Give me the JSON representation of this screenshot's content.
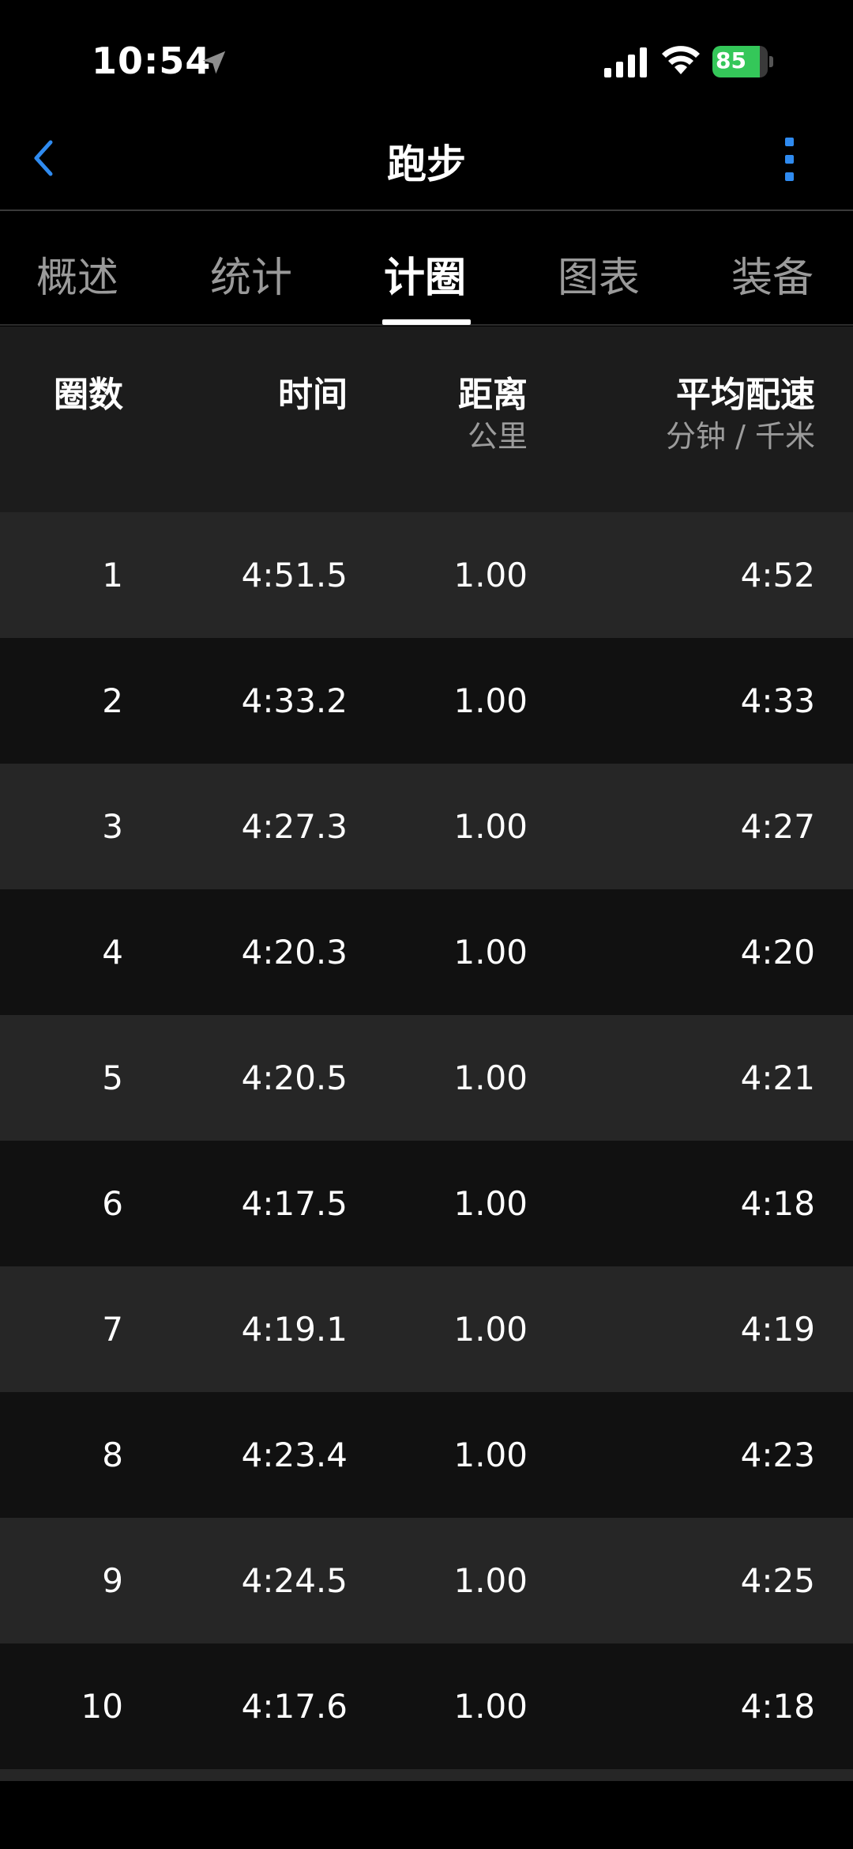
{
  "status_bar": {
    "time": "10:54",
    "battery": "85",
    "battery_level": 0.85,
    "icons": [
      "location-arrow-icon",
      "signal-icon",
      "wifi-icon",
      "battery-charging-icon"
    ]
  },
  "nav": {
    "title": "跑步",
    "back_icon": "chevron-left-icon",
    "more_icon": "more-vertical-icon",
    "accent_color": "#2f8bf0"
  },
  "tabs": [
    {
      "label": "概述"
    },
    {
      "label": "统计"
    },
    {
      "label": "计圈",
      "active": true
    },
    {
      "label": "图表"
    },
    {
      "label": "装备"
    }
  ],
  "table": {
    "headers": {
      "lap": "圈数",
      "time": "时间",
      "distance": "距离",
      "distance_unit": "公里",
      "pace": "平均配速",
      "pace_unit": "分钟 / 千米"
    },
    "rows": [
      {
        "lap": "1",
        "time": "4:51.5",
        "distance": "1.00",
        "pace": "4:52"
      },
      {
        "lap": "2",
        "time": "4:33.2",
        "distance": "1.00",
        "pace": "4:33"
      },
      {
        "lap": "3",
        "time": "4:27.3",
        "distance": "1.00",
        "pace": "4:27"
      },
      {
        "lap": "4",
        "time": "4:20.3",
        "distance": "1.00",
        "pace": "4:20"
      },
      {
        "lap": "5",
        "time": "4:20.5",
        "distance": "1.00",
        "pace": "4:21"
      },
      {
        "lap": "6",
        "time": "4:17.5",
        "distance": "1.00",
        "pace": "4:18"
      },
      {
        "lap": "7",
        "time": "4:19.1",
        "distance": "1.00",
        "pace": "4:19"
      },
      {
        "lap": "8",
        "time": "4:23.4",
        "distance": "1.00",
        "pace": "4:23"
      },
      {
        "lap": "9",
        "time": "4:24.5",
        "distance": "1.00",
        "pace": "4:25"
      },
      {
        "lap": "10",
        "time": "4:17.6",
        "distance": "1.00",
        "pace": "4:18"
      }
    ]
  }
}
